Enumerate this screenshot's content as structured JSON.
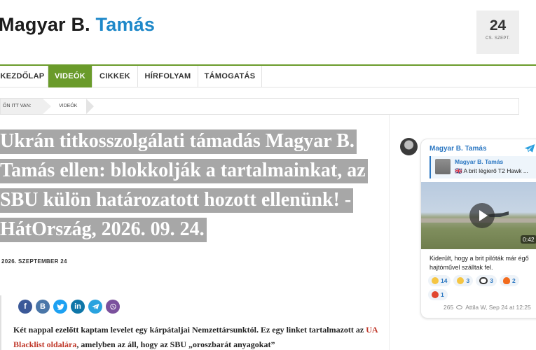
{
  "header": {
    "title_first": "Magyar B.",
    "title_last": "Tamás",
    "date_day": "24",
    "date_month": "CS. SZEPT."
  },
  "nav": {
    "items": [
      "KEZDŐLAP",
      "VIDEÓK",
      "CIKKEK",
      "HÍRFOLYAM",
      "TÁMOGATÁS"
    ],
    "active": "VIDEÓK"
  },
  "breadcrumb": {
    "here_label": "ÖN ITT VAN:",
    "current": "VIDEÓK"
  },
  "article": {
    "headline": "Ukrán titkosszolgálati támadás Magyar B. Tamás ellen: blokkolják a tartalmainkat, az SBU külön határozatott hozott ellenünk! - HátOrszág, 2026. 09. 24.",
    "date": "2026. SZEPTEMBER 24",
    "para_before": "Két nappal ezelőtt kaptam levelet egy kárpátaljai Nemzettársunktól. Ez egy linket tartalmazott az ",
    "para_link": "UA Blacklist oldalára",
    "para_after": ", amelyben az áll, hogy az SBU „oroszbarát anyagokat”"
  },
  "share_icons": [
    "facebook-icon",
    "vk-icon",
    "twitter-icon",
    "linkedin-icon",
    "telegram-icon",
    "viber-icon"
  ],
  "telegram": {
    "channel": "Magyar B. Tamás",
    "reply_name": "Magyar B. Tamás",
    "reply_text": "🇬🇧 A brit légierő T2 Hawk ...",
    "video_duration": "0:42",
    "message": "Kiderült, hogy a brit pilóták már égő hajtóművel szálltak fel.",
    "reactions": [
      {
        "emoji": "🤔",
        "count": "14"
      },
      {
        "emoji": "😁",
        "count": "3"
      },
      {
        "emoji": "👀",
        "count": "3"
      },
      {
        "emoji": "🔥",
        "count": "2"
      },
      {
        "emoji": "😡",
        "count": "1"
      }
    ],
    "views": "265",
    "meta": "Attila W, Sep 24 at 12:25"
  },
  "colors": {
    "brand_blue": "#1e88c9",
    "nav_green": "#6a9b2a",
    "link_red": "#c0392b",
    "tg_blue": "#2b77c2"
  }
}
